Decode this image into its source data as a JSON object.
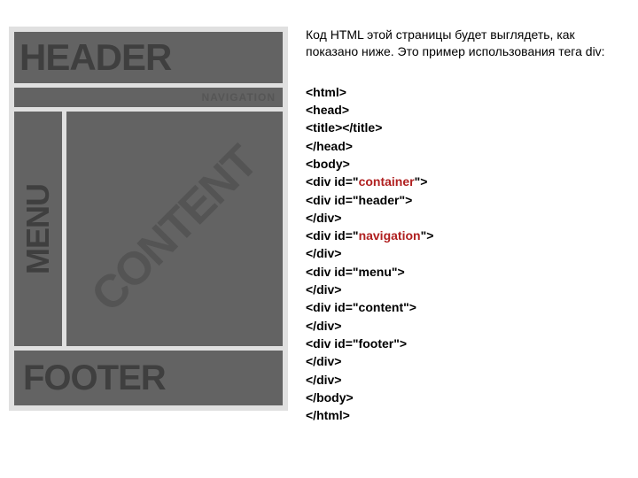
{
  "wire": {
    "header": "HEADER",
    "nav": "NAVIGATION",
    "menu": "MENU",
    "content": "CONTENT",
    "footer": "FOOTER"
  },
  "intro": "Код HTML этой страницы будет выглядеть, как показано ниже. Это пример использования тега div:",
  "code": {
    "l1": "<html>",
    "l2": "<head>",
    "l3": " <title></title>",
    "l4": " </head>",
    "l5": " <body>",
    "l6a": " <div id=\"",
    "l6b": "container",
    "l6c": "\">",
    "l7": "<div id=\"header\">",
    "l8": " </div>",
    "l9a": " <div id=\"",
    "l9b": "navigation",
    "l9c": "\">",
    "l10": " </div>",
    "l11": " <div id=\"menu\">",
    "l12": " </div>",
    "l13": " <div id=\"content\">",
    "l14": " </div>",
    "l15": " <div id=\"footer\">",
    "l16": " </div>",
    "l17": " </div>",
    "l18": " </body>",
    "l19": " </html>"
  }
}
